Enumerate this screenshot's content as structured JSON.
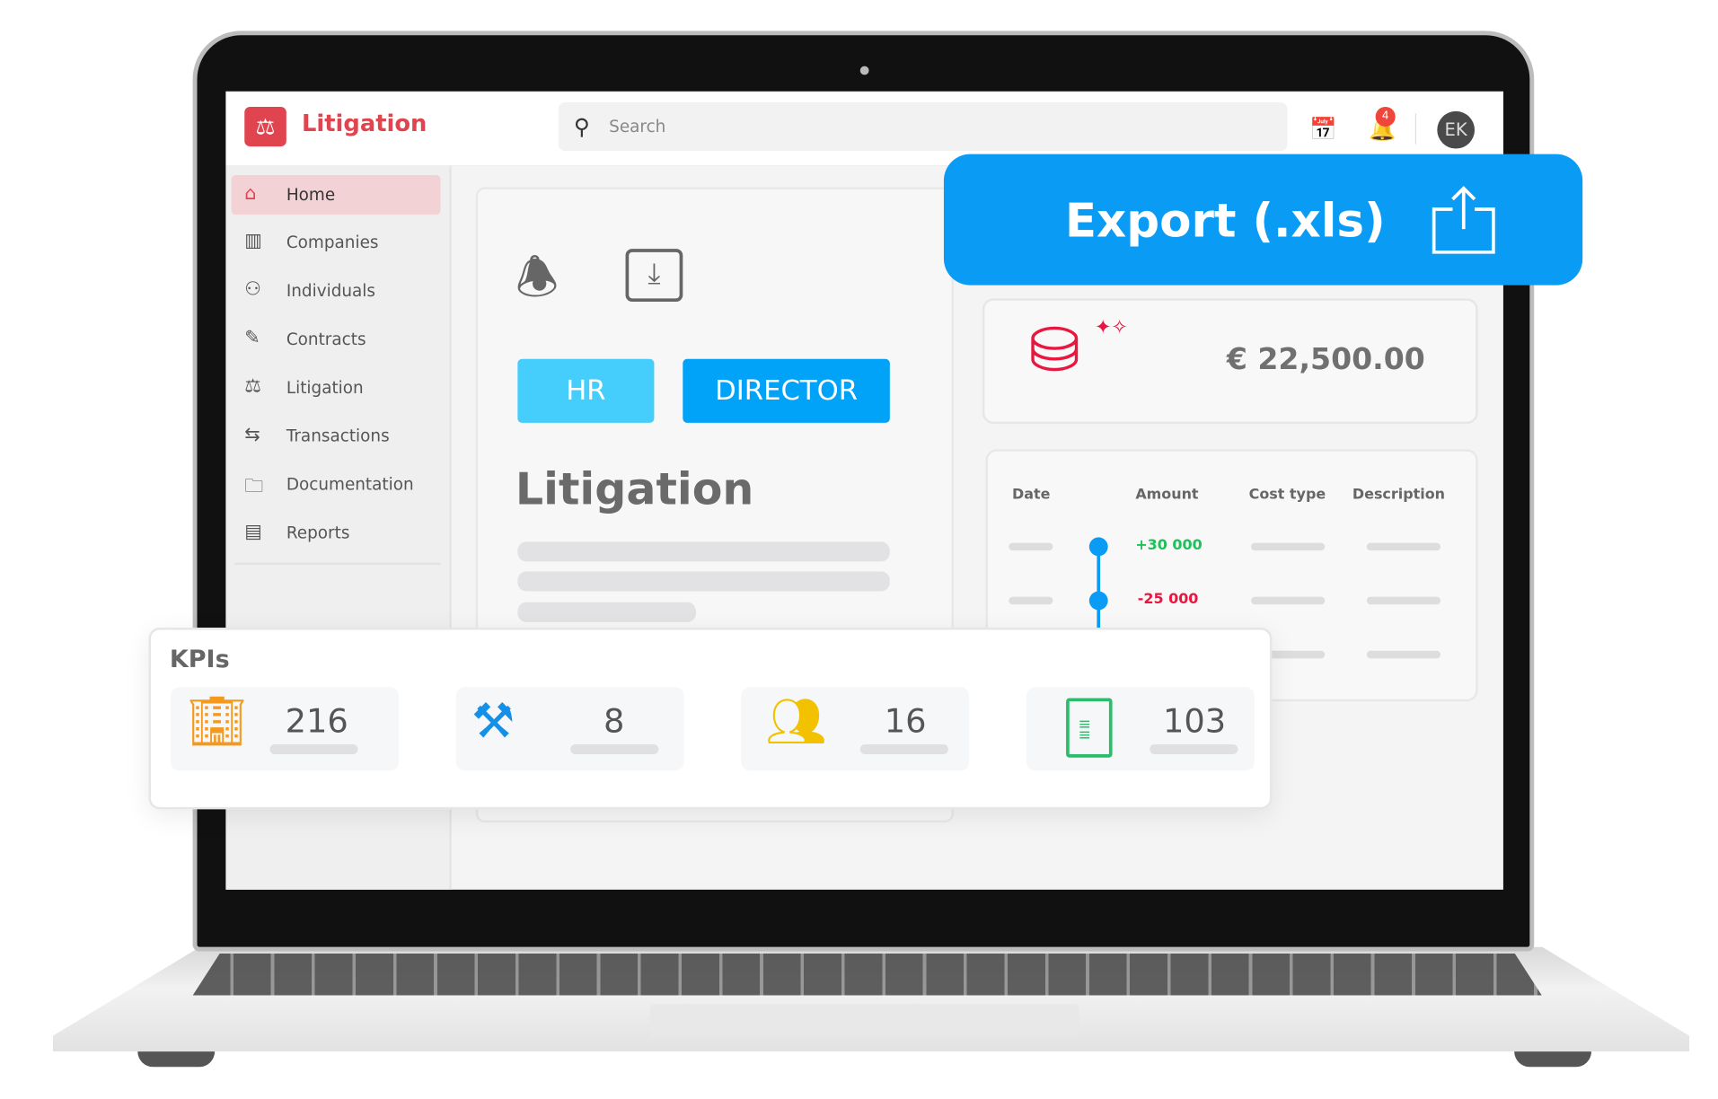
{
  "app": {
    "title": "Litigation",
    "search_placeholder": "Search",
    "notification_count": "4",
    "avatar_initials": "EK"
  },
  "sidebar": {
    "items": [
      {
        "label": "Home",
        "icon": "home-icon",
        "active": true
      },
      {
        "label": "Companies",
        "icon": "building-icon"
      },
      {
        "label": "Individuals",
        "icon": "users-icon"
      },
      {
        "label": "Contracts",
        "icon": "contract-icon"
      },
      {
        "label": "Litigation",
        "icon": "gavel-icon"
      },
      {
        "label": "Transactions",
        "icon": "transfer-icon"
      },
      {
        "label": "Documentation",
        "icon": "folder-icon"
      },
      {
        "label": "Reports",
        "icon": "report-icon"
      }
    ]
  },
  "main": {
    "roles": [
      "HR",
      "DIRECTOR"
    ],
    "heading": "Litigation"
  },
  "export": {
    "label": "Export (.xls)"
  },
  "money": {
    "amount": "€ 22,500.00"
  },
  "transactions": {
    "columns": [
      "Date",
      "Amount",
      "Cost type",
      "Description"
    ],
    "rows": [
      {
        "amount": "+30 000",
        "color": "#1fbf5a"
      },
      {
        "amount": "-25 000",
        "color": "#e8173f"
      }
    ]
  },
  "kpis": {
    "title": "KPIs",
    "items": [
      {
        "value": "216",
        "icon": "building-icon",
        "color": "#f39a1e"
      },
      {
        "value": "8",
        "icon": "gavel-icon",
        "color": "#1590e8"
      },
      {
        "value": "16",
        "icon": "users-icon",
        "color": "#f2c200"
      },
      {
        "value": "103",
        "icon": "document-icon",
        "color": "#2bbd6b"
      }
    ]
  },
  "colors": {
    "brand": "#e0454f",
    "export": "#0a9cf5",
    "hr": "#45cdfb",
    "director": "#00a3f8"
  }
}
